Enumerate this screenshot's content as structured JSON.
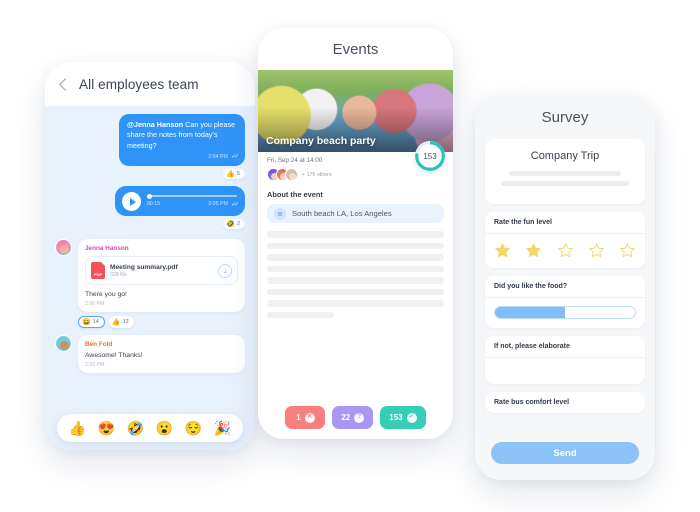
{
  "chat": {
    "header": {
      "title": "All employees team",
      "back_icon": "chevron-left-icon"
    },
    "outgoing_message": {
      "mention": "@Jenna Hanson",
      "text": " Can you please share the notes from today's meeting?",
      "time": "2:04 PM",
      "ticks": "✓✓",
      "reaction": {
        "emoji": "👍",
        "count": "5"
      }
    },
    "voice_message": {
      "play_icon": "play-icon",
      "duration": "00:15",
      "time": "2:05 PM",
      "ticks": "✓✓",
      "reaction": {
        "emoji": "🤣",
        "count": "2"
      }
    },
    "incoming_1": {
      "sender": "Jenna Hanson",
      "file": {
        "name": "Meeting summary.pdf",
        "size": "328 Kb",
        "type_label": "PDF",
        "download_icon": "download-icon"
      },
      "text": "There you go!",
      "time": "2:06 PM",
      "reactions": [
        {
          "emoji": "😄",
          "count": "14"
        },
        {
          "emoji": "👍",
          "count": "12"
        }
      ]
    },
    "incoming_2": {
      "sender": "Ben Fold",
      "text": "Awesome! Thanks!",
      "time": "2:15 PM"
    },
    "emoji_bar": [
      {
        "icon": "thumbs-up-emoji",
        "glyph": "👍"
      },
      {
        "icon": "heart-eyes-emoji",
        "glyph": "😍"
      },
      {
        "icon": "joy-emoji",
        "glyph": "🤣"
      },
      {
        "icon": "surprised-emoji",
        "glyph": "😮"
      },
      {
        "icon": "relieved-emoji",
        "glyph": "😌"
      },
      {
        "icon": "party-popper-emoji",
        "glyph": "🎉"
      }
    ]
  },
  "events": {
    "title": "Events",
    "hero_caption": "Company beach party",
    "date": "Fri, Sep 24 at 14:00",
    "attendees_more": "+ 176 others",
    "going_count": "153",
    "section_title": "About the event",
    "location": "South beach LA, Los Angeles",
    "location_icon": "map-pin-icon",
    "rsvp": [
      {
        "count": "1",
        "glyph": "✕",
        "state": "no"
      },
      {
        "count": "22",
        "glyph": "?",
        "state": "maybe"
      },
      {
        "count": "153",
        "glyph": "✓",
        "state": "yes"
      }
    ]
  },
  "survey": {
    "title": "Survey",
    "form_title": "Company Trip",
    "questions": [
      {
        "label": "Rate the fun level",
        "type": "stars",
        "value": 2,
        "max": 5
      },
      {
        "label": "Did you like the food?",
        "type": "slider",
        "value": 50
      },
      {
        "label": "If not, please elaborate",
        "type": "textarea",
        "value": ""
      },
      {
        "label": "Rate bus comfort level",
        "type": "stars-hidden"
      }
    ],
    "send_label": "Send"
  },
  "colors": {
    "bubble_blue": "#2f93f7",
    "chat_bg": "#e8f2fd",
    "teal": "#36cfb6",
    "coral": "#f7807e",
    "purple": "#a997f2",
    "star_yellow": "#f8d765",
    "send_blue": "#8cc3f8"
  }
}
